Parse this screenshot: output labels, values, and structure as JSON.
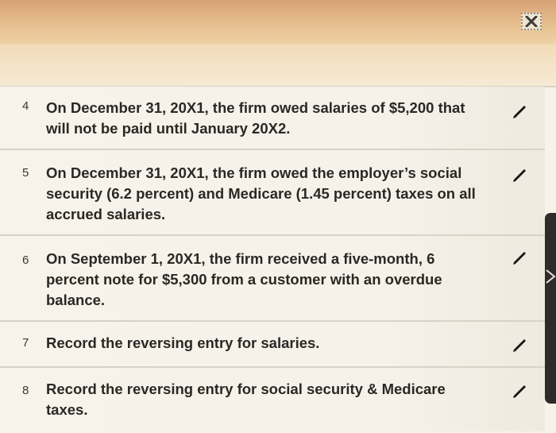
{
  "dialog": {
    "close_icon": "close-x-icon",
    "edit_icon": "pencil-icon"
  },
  "items": [
    {
      "number": "4",
      "text": "On December 31, 20X1, the firm owed salaries of $5,200 that will not be paid until January 20X2."
    },
    {
      "number": "5",
      "text": "On December 31, 20X1, the firm owed the employer’s social security (6.2 percent) and Medicare (1.45 percent) taxes on all accrued salaries."
    },
    {
      "number": "6",
      "text": "On September 1, 20X1, the firm received a five-month, 6 percent note for $5,300 from a customer with an overdue balance."
    },
    {
      "number": "7",
      "text": "Record the reversing entry for salaries."
    },
    {
      "number": "8",
      "text": "Record the reversing entry for social security & Medicare taxes."
    }
  ]
}
